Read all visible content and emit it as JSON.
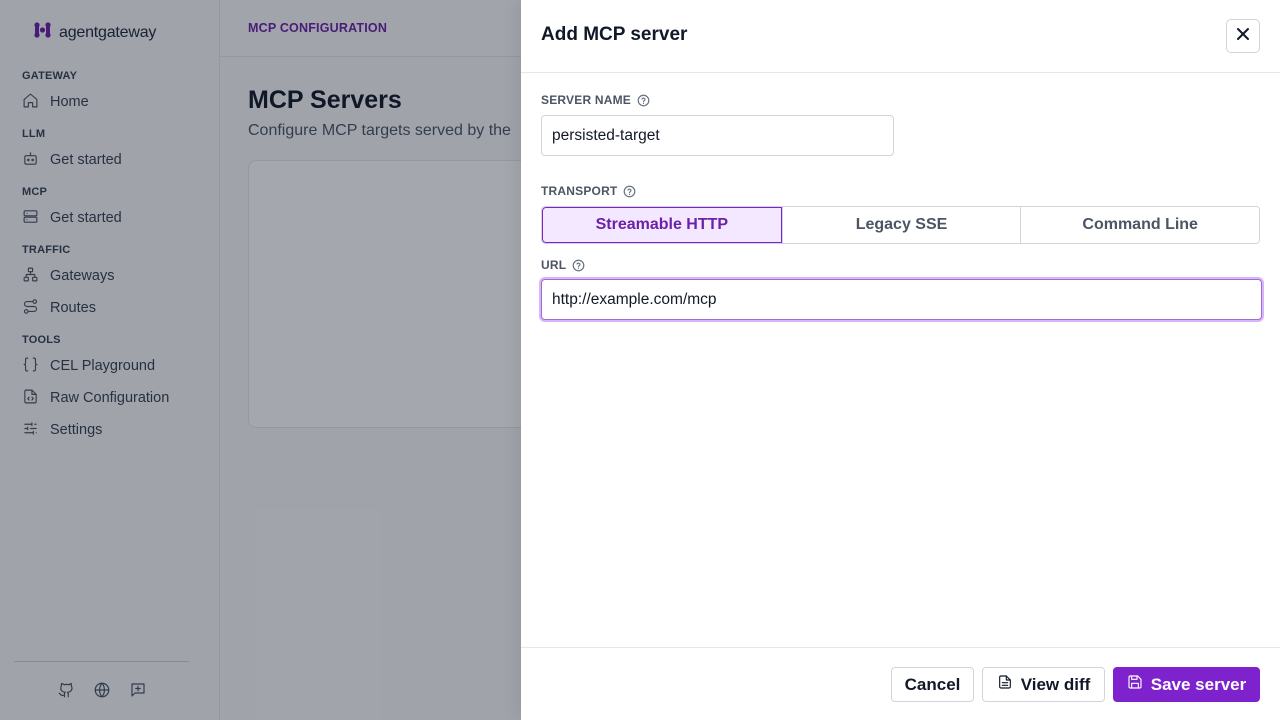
{
  "app": {
    "logo_text": "agentgateway",
    "brand_color": "#7e22ce"
  },
  "sidebar": {
    "sections": [
      {
        "label": "GATEWAY",
        "items": [
          {
            "label": "Home",
            "icon": "home-icon"
          }
        ]
      },
      {
        "label": "LLM",
        "items": [
          {
            "label": "Get started",
            "icon": "bot-icon"
          }
        ]
      },
      {
        "label": "MCP",
        "items": [
          {
            "label": "Get started",
            "icon": "server-icon"
          }
        ]
      },
      {
        "label": "TRAFFIC",
        "items": [
          {
            "label": "Gateways",
            "icon": "network-icon"
          },
          {
            "label": "Routes",
            "icon": "route-icon"
          }
        ]
      },
      {
        "label": "TOOLS",
        "items": [
          {
            "label": "CEL Playground",
            "icon": "braces-icon"
          },
          {
            "label": "Raw Configuration",
            "icon": "file-code-icon"
          },
          {
            "label": "Settings",
            "icon": "sliders-icon"
          }
        ]
      }
    ],
    "footer_icons": [
      "github-icon",
      "globe-icon",
      "feedback-icon"
    ]
  },
  "main": {
    "breadcrumb": "MCP CONFIGURATION",
    "title": "MCP Servers",
    "subtitle": "Configure MCP targets served by the"
  },
  "drawer": {
    "title": "Add MCP server",
    "server_name_label": "SERVER NAME",
    "server_name_value": "persisted-target",
    "transport_label": "TRANSPORT",
    "transport_options": [
      "Streamable HTTP",
      "Legacy SSE",
      "Command Line"
    ],
    "transport_selected": "Streamable HTTP",
    "url_label": "URL",
    "url_value": "http://example.com/mcp",
    "buttons": {
      "cancel": "Cancel",
      "view_diff": "View diff",
      "save": "Save server"
    }
  }
}
